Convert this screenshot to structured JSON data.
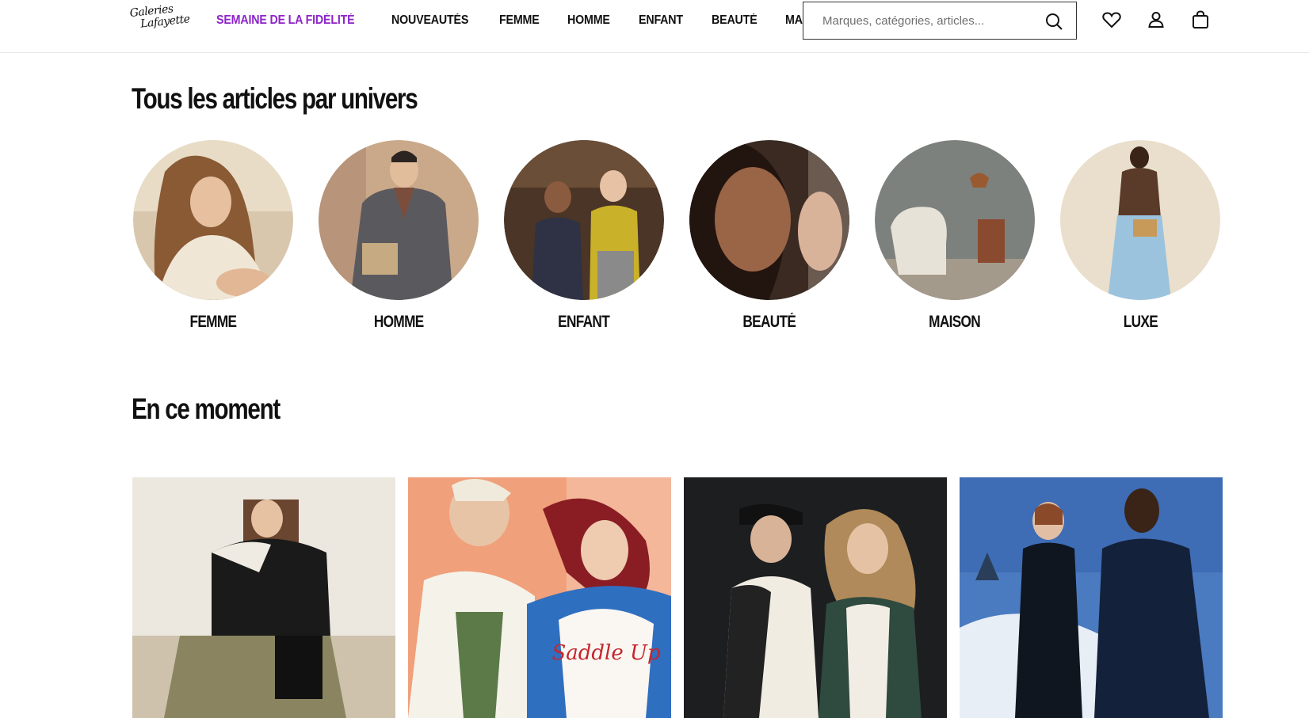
{
  "header": {
    "logo_line1": "Galeries",
    "logo_line2": "Lafayette",
    "nav": [
      {
        "label": "SEMAINE DE LA FIDÉLITÉ",
        "highlight": true
      },
      {
        "label": "NOUVEAUTÉS"
      },
      {
        "label": "FEMME"
      },
      {
        "label": "HOMME"
      },
      {
        "label": "ENFANT"
      },
      {
        "label": "BEAUTÉ"
      },
      {
        "label": "MAISON"
      }
    ],
    "search": {
      "placeholder": "Marques, catégories, articles..."
    },
    "icons": [
      "heart-icon",
      "user-icon",
      "bag-icon"
    ]
  },
  "univers": {
    "title": "Tous les articles par univers",
    "items": [
      {
        "label": "FEMME"
      },
      {
        "label": "HOMME"
      },
      {
        "label": "ENFANT"
      },
      {
        "label": "BEAUTÉ"
      },
      {
        "label": "MAISON"
      },
      {
        "label": "LUXE"
      }
    ]
  },
  "moment": {
    "title": "En ce moment",
    "card_text": "Saddle Up"
  },
  "colors": {
    "promo": "#8e24c9",
    "text": "#111111",
    "border": "#e6e6e6"
  }
}
